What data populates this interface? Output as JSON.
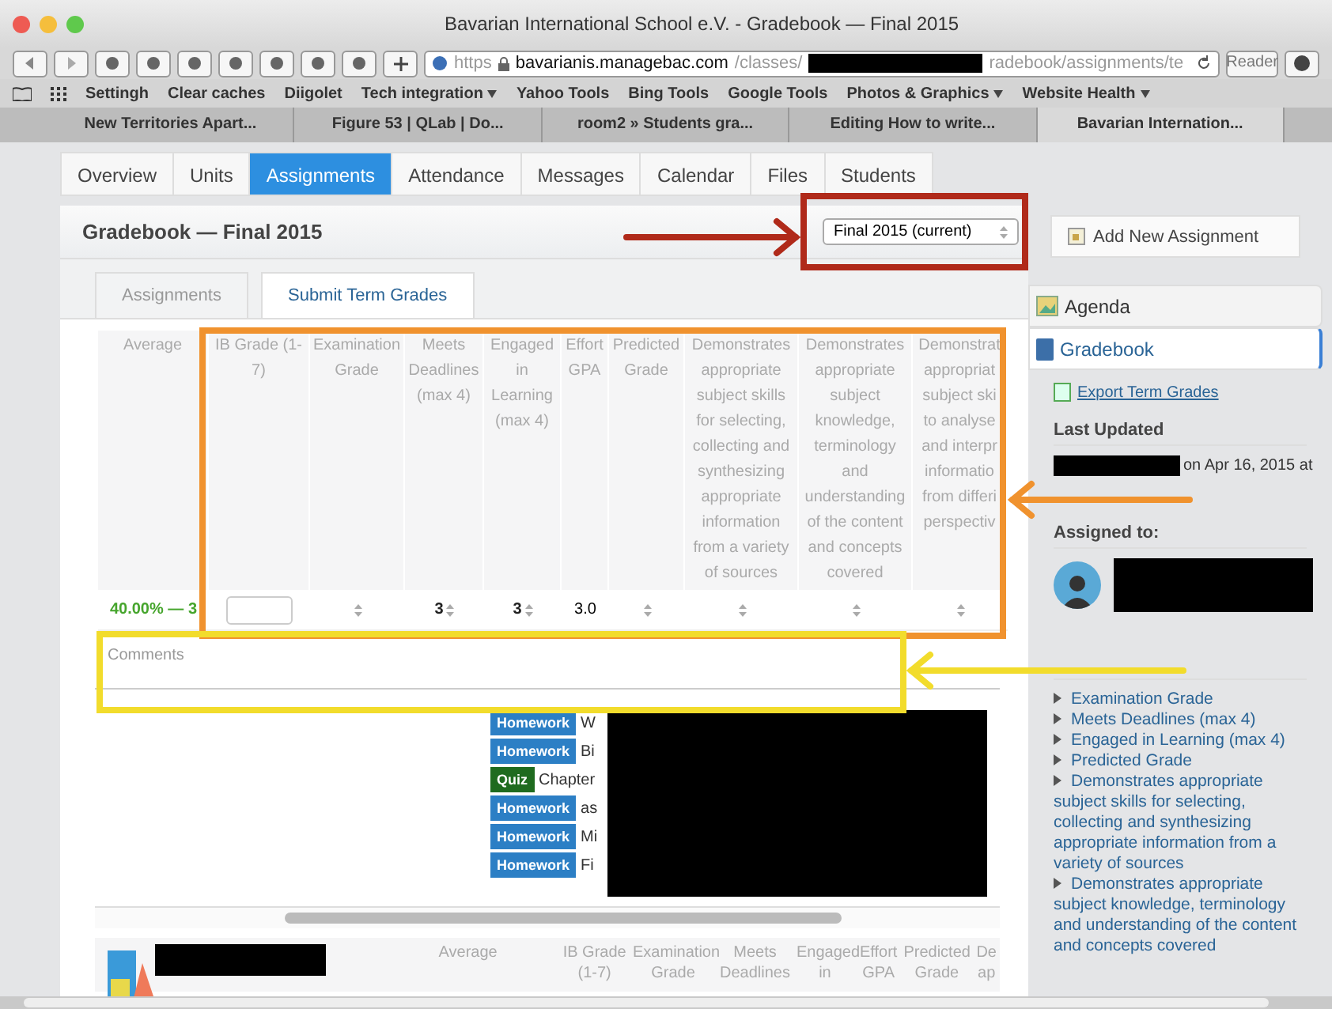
{
  "window": {
    "title": "Bavarian International School e.V. - Gradebook — Final 2015"
  },
  "toolbar": {
    "scheme": "https",
    "host": "bavarianis.managebac.com",
    "path_start": "/classes/",
    "path_end": "radebook/assignments/te",
    "reader": "Reader"
  },
  "bookmarks": [
    {
      "label": "Settingh",
      "menu": false
    },
    {
      "label": "Clear caches",
      "menu": false
    },
    {
      "label": "Diigolet",
      "menu": false
    },
    {
      "label": "Tech integration",
      "menu": true
    },
    {
      "label": "Yahoo Tools",
      "menu": false
    },
    {
      "label": "Bing Tools",
      "menu": false
    },
    {
      "label": "Google Tools",
      "menu": false
    },
    {
      "label": "Photos & Graphics",
      "menu": true
    },
    {
      "label": "Website Health",
      "menu": true
    }
  ],
  "browser_tabs": [
    {
      "label": "New Territories Apart...",
      "selected": false
    },
    {
      "label": "Figure 53 | QLab | Do...",
      "selected": false
    },
    {
      "label": "room2 » Students gra...",
      "selected": false
    },
    {
      "label": "Editing How to write...",
      "selected": false
    },
    {
      "label": "Bavarian Internation...",
      "selected": true
    }
  ],
  "nav_tabs": [
    {
      "label": "Overview",
      "selected": false
    },
    {
      "label": "Units",
      "selected": false
    },
    {
      "label": "Assignments",
      "selected": true
    },
    {
      "label": "Attendance",
      "selected": false
    },
    {
      "label": "Messages",
      "selected": false
    },
    {
      "label": "Calendar",
      "selected": false
    },
    {
      "label": "Files",
      "selected": false
    },
    {
      "label": "Students",
      "selected": false
    }
  ],
  "gradebook": {
    "title": "Gradebook — Final 2015",
    "term_select": "Final 2015 (current)",
    "subtabs": [
      {
        "label": "Assignments",
        "selected": false
      },
      {
        "label": "Submit Term Grades",
        "selected": true
      }
    ],
    "columns": [
      "Average",
      "IB Grade (1-7)",
      "Examination Grade",
      "Meets Deadlines (max 4)",
      "Engaged in Learning (max 4)",
      "Effort GPA",
      "Predicted Grade",
      "Demonstrates appropriate subject skills for selecting, collecting and synthesizing appropriate information from a variety of sources",
      "Demonstrates appropriate subject knowledge, terminology and understanding of the content and concepts covered",
      "Demonstrat appropriat subject ski to analyse and interpr informatio from differi perspectiv"
    ],
    "row": [
      {
        "kind": "average",
        "value": "40.00% — 3"
      },
      {
        "kind": "input"
      },
      {
        "kind": "select"
      },
      {
        "kind": "select",
        "value": "3"
      },
      {
        "kind": "select",
        "value": "3"
      },
      {
        "kind": "text",
        "value": "3.0"
      },
      {
        "kind": "select"
      },
      {
        "kind": "select"
      },
      {
        "kind": "select"
      },
      {
        "kind": "select"
      }
    ],
    "comments_placeholder": "Comments",
    "assignments": [
      {
        "kind": "homework",
        "tag": "Homework",
        "title": "W"
      },
      {
        "kind": "homework",
        "tag": "Homework",
        "title": "Bi"
      },
      {
        "kind": "quiz",
        "tag": "Quiz",
        "title": "Chapter"
      },
      {
        "kind": "homework",
        "tag": "Homework",
        "title": "as"
      },
      {
        "kind": "homework",
        "tag": "Homework",
        "title": "Mi"
      },
      {
        "kind": "homework",
        "tag": "Homework",
        "title": "Fi"
      }
    ],
    "next_columns": [
      "Average",
      "IB Grade (1-7)",
      "Examination Grade",
      "Meets Deadlines",
      "Engaged in",
      "Effort GPA",
      "Predicted Grade",
      "De ap"
    ]
  },
  "sidebar": {
    "add_button": "Add New Assignment",
    "sections": [
      {
        "label": "Agenda",
        "selected": false
      },
      {
        "label": "Gradebook",
        "selected": true
      }
    ],
    "export_link": "Export Term Grades",
    "last_updated_heading": "Last Updated",
    "last_updated": "on Apr 16, 2015 at",
    "assigned_heading": "Assigned to:",
    "rubrics": [
      "Examination Grade",
      "Meets Deadlines (max 4)",
      "Engaged in Learning (max 4)",
      "Predicted Grade",
      "Demonstrates appropriate subject skills for selecting, collecting and synthesizing appropriate information from a variety of sources",
      "Demonstrates appropriate subject knowledge, terminology and understanding of the content and concepts covered"
    ]
  }
}
